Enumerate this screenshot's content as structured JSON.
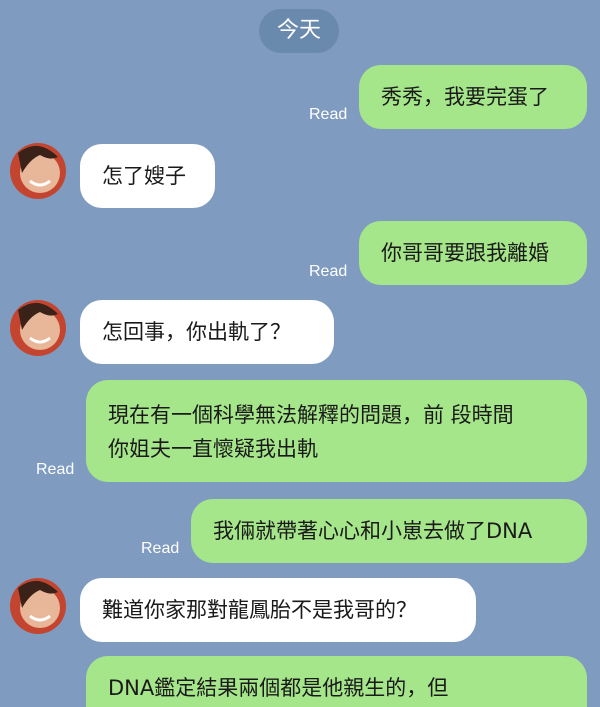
{
  "date_label": "今天",
  "read_label": "Read",
  "messages": [
    {
      "side": "me",
      "text": "秀秀，我要完蛋了"
    },
    {
      "side": "other",
      "text": "怎了嫂子"
    },
    {
      "side": "me",
      "text": "你哥哥要跟我離婚"
    },
    {
      "side": "other",
      "text": "怎回事，你出軌了？"
    },
    {
      "side": "me",
      "lines": [
        "現在有一個科學無法解釋的問題，前 段時間",
        "你姐夫一直懷疑我出軌"
      ]
    },
    {
      "side": "me",
      "text": "我倆就帶著心心和小崽去做了DNA"
    },
    {
      "side": "other",
      "text": "難道你家那對龍鳳胎不是我哥的？"
    },
    {
      "side": "me",
      "text": "DNA鑑定結果兩個都是他親生的，但"
    }
  ],
  "colors": {
    "background": "#7f9cc0",
    "my_bubble": "#a6e68a",
    "their_bubble": "#ffffff",
    "date_pill": "#6a8aad"
  }
}
